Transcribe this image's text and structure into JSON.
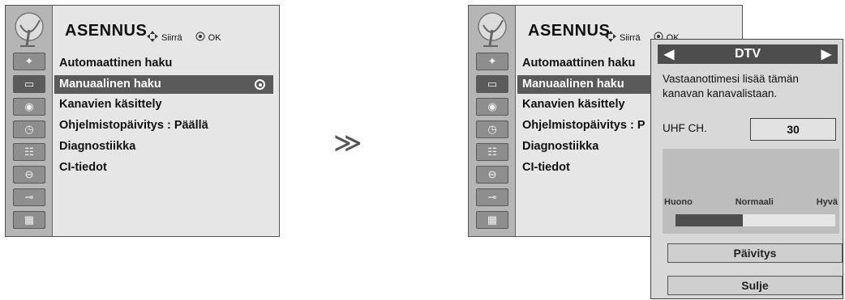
{
  "left_panel": {
    "title": "ASENNUS",
    "hint_move": "Siirrä",
    "hint_ok": "OK",
    "menu_items": [
      {
        "label": "Automaattinen haku"
      },
      {
        "label": "Manuaalinen haku"
      },
      {
        "label": "Kanavien käsittely"
      },
      {
        "label": "Ohjelmistopäivitys : Päällä"
      },
      {
        "label": "Diagnostiikka"
      },
      {
        "label": "CI-tiedot"
      }
    ],
    "selected_index": 1
  },
  "right_panel": {
    "title": "ASENNUS",
    "hint_move": "Siirrä",
    "hint_ok": "OK",
    "menu_items": [
      {
        "label": "Automaattinen haku"
      },
      {
        "label": "Manuaalinen haku"
      },
      {
        "label": "Kanavien käsittely"
      },
      {
        "label": "Ohjelmistopäivitys : P"
      },
      {
        "label": "Diagnostiikka"
      },
      {
        "label": "CI-tiedot"
      }
    ],
    "selected_index": 1
  },
  "rail_icons": [
    "satellite-icon",
    "tv-picture-icon",
    "audio-disc-icon",
    "clock-icon",
    "option-icon",
    "lock-icon",
    "input-plug-icon",
    "clapper-icon"
  ],
  "arrow": "≫",
  "popup": {
    "header": "DTV",
    "message": "Vastaanottimesi lisää tämän kanavan kanavalistaan.",
    "channel_label": "UHF CH.",
    "channel_value": "30",
    "signal_labels": {
      "bad": "Huono",
      "normal": "Normaali",
      "good": "Hyvä"
    },
    "signal_level": 0.42,
    "update_button": "Päivitys",
    "close_button": "Sulje"
  },
  "colors": {
    "menu_bg": "#e6e6e6",
    "rail_bg": "#b5b5b5",
    "selected_bg": "#5a5a5a",
    "popup_bg": "#d8d8d8"
  }
}
